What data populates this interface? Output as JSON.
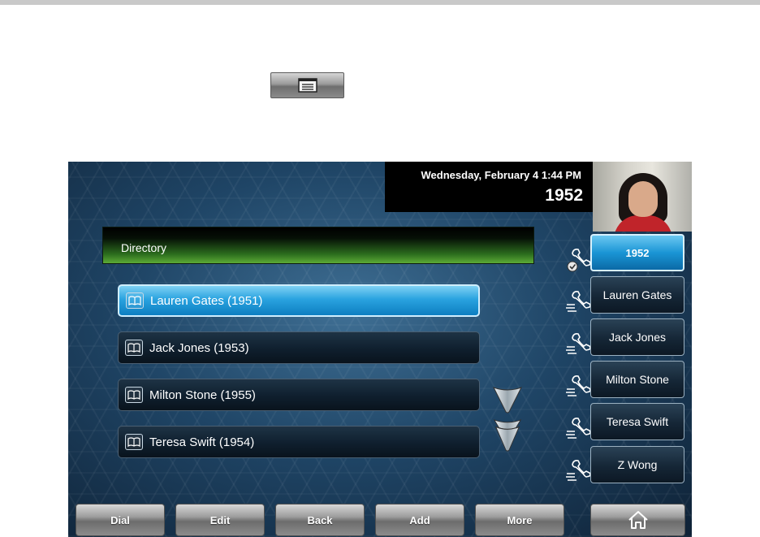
{
  "hard_key": {
    "icon": "menu-icon"
  },
  "status": {
    "date_time": "Wednesday, February 4  1:44 PM",
    "extension": "1952"
  },
  "directory": {
    "title": "Directory",
    "entries": [
      {
        "label": "Lauren Gates (1951)",
        "selected": true
      },
      {
        "label": "Jack Jones (1953)",
        "selected": false
      },
      {
        "label": "Milton Stone (1955)",
        "selected": false
      },
      {
        "label": "Teresa Swift (1954)",
        "selected": false
      }
    ]
  },
  "line_keys": [
    {
      "label": "1952",
      "active": true,
      "icon": "phone-check-icon"
    },
    {
      "label": "Lauren Gates",
      "active": false,
      "icon": "phone-speed-dial-icon"
    },
    {
      "label": "Jack Jones",
      "active": false,
      "icon": "phone-speed-dial-icon"
    },
    {
      "label": "Milton Stone",
      "active": false,
      "icon": "phone-speed-dial-icon"
    },
    {
      "label": "Teresa Swift",
      "active": false,
      "icon": "phone-speed-dial-icon"
    },
    {
      "label": "Z Wong",
      "active": false,
      "icon": "phone-speed-dial-icon"
    }
  ],
  "softkeys": [
    {
      "label": "Dial"
    },
    {
      "label": "Edit"
    },
    {
      "label": "Back"
    },
    {
      "label": "Add"
    },
    {
      "label": "More"
    }
  ],
  "home_key": {
    "icon": "home-icon"
  }
}
